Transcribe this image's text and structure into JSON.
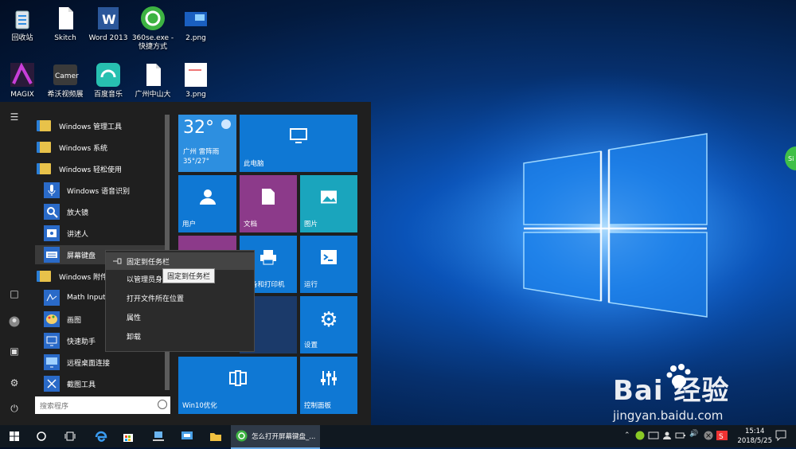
{
  "desktop_icons": [
    {
      "id": "recycle",
      "label": "回收站",
      "icon": "recycle-bin-icon"
    },
    {
      "id": "skitch",
      "label": "Skitch",
      "icon": "file-icon"
    },
    {
      "id": "word",
      "label": "Word 2013",
      "icon": "word-icon"
    },
    {
      "id": "360se",
      "label": "360se.exe - 快捷方式",
      "icon": "360-browser-icon"
    },
    {
      "id": "png2",
      "label": "2.png",
      "icon": "image-file-icon"
    },
    {
      "id": "magix",
      "label": "MAGIX",
      "icon": "magix-icon"
    },
    {
      "id": "camera",
      "label": "希沃视频展",
      "icon": "camera-icon"
    },
    {
      "id": "music",
      "label": "百度音乐",
      "icon": "baidu-music-icon"
    },
    {
      "id": "gz",
      "label": "广州中山大",
      "icon": "file-icon"
    },
    {
      "id": "png3",
      "label": "3.png",
      "icon": "image-file-icon"
    }
  ],
  "start_menu": {
    "apps": [
      {
        "label": "Windows 管理工具",
        "type": "folder"
      },
      {
        "label": "Windows 系统",
        "type": "folder"
      },
      {
        "label": "Windows 轻松使用",
        "type": "folder"
      },
      {
        "label": "Windows 语音识别",
        "type": "app"
      },
      {
        "label": "放大镜",
        "type": "app"
      },
      {
        "label": "讲述人",
        "type": "app"
      },
      {
        "label": "屏幕键盘",
        "type": "app"
      },
      {
        "label": "Windows 附件",
        "type": "folder"
      },
      {
        "label": "Math Input",
        "type": "app"
      },
      {
        "label": "画图",
        "type": "app"
      },
      {
        "label": "快速助手",
        "type": "app"
      },
      {
        "label": "远程桌面连接",
        "type": "app"
      },
      {
        "label": "截图工具",
        "type": "app"
      }
    ],
    "search_placeholder": "搜索程序",
    "tiles": {
      "weather_temp": "32°",
      "weather_desc": "广州 雷阵雨",
      "weather_range": "35°/27°",
      "pc": "此电脑",
      "user": "用户",
      "docs": "文档",
      "pictures": "图片",
      "printers": "备和打印机",
      "run": "运行",
      "settings": "设置",
      "win10": "Win10优化",
      "control": "控制面板"
    }
  },
  "context_menu": {
    "items": [
      "固定到任务栏",
      "以管理员身份运行",
      "打开文件所在位置",
      "属性",
      "卸载"
    ],
    "tooltip": "固定到任务栏"
  },
  "taskbar": {
    "active_task": "怎么打开屏幕键盘_...",
    "time": "15:14",
    "date": "2018/5/25"
  },
  "watermark": {
    "brand": "Bai  经验",
    "sub": "jingyan.baidu.com"
  },
  "floating_badge": "Si"
}
